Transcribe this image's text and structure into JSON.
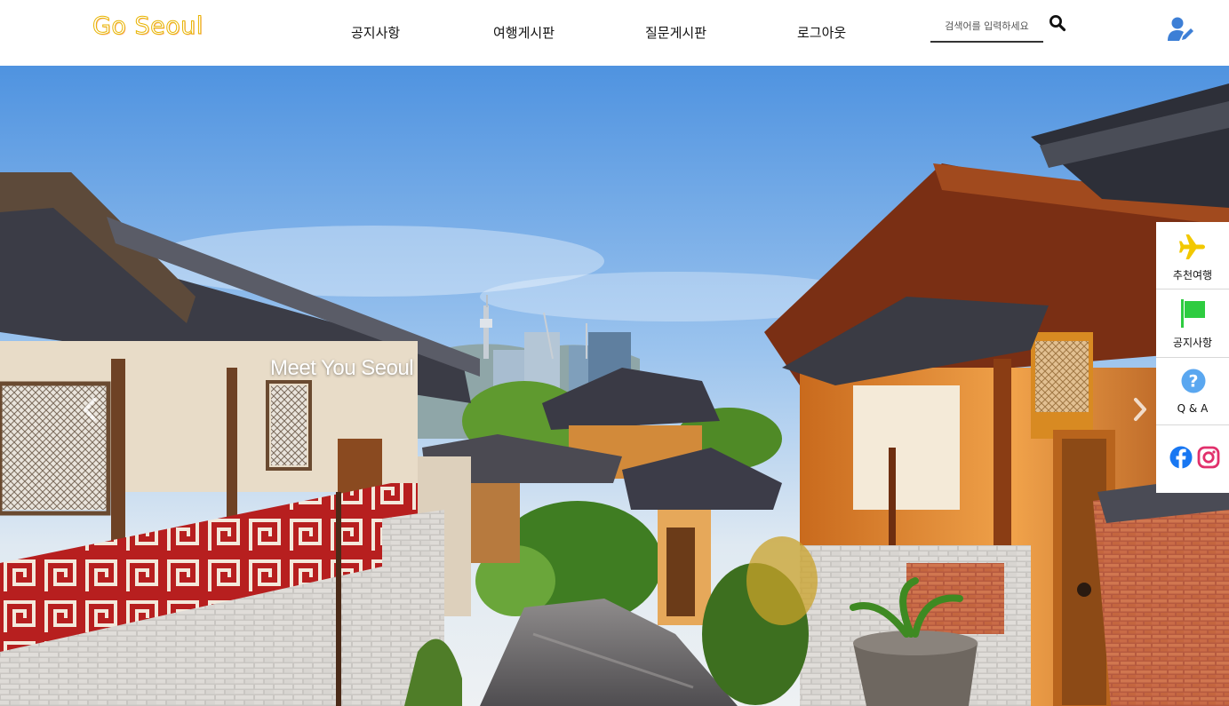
{
  "header": {
    "logo": "Go Seoul",
    "nav": [
      {
        "label": "공지사항"
      },
      {
        "label": "여행게시판"
      },
      {
        "label": "질문게시판"
      },
      {
        "label": "로그아웃"
      }
    ],
    "search": {
      "placeholder": "검색어를 입력하세요",
      "value": ""
    },
    "icons": {
      "search": "search-icon",
      "user": "user-edit-icon"
    }
  },
  "hero": {
    "caption": "Meet You Seoul",
    "prev_icon": "chevron-left-icon",
    "next_icon": "chevron-right-icon"
  },
  "quick_menu": {
    "items": [
      {
        "label": "추천여행",
        "icon": "airplane-icon"
      },
      {
        "label": "공지사항",
        "icon": "flag-icon"
      },
      {
        "label": "Q & A",
        "icon": "question-icon"
      }
    ],
    "social": [
      {
        "icon": "facebook-icon"
      },
      {
        "icon": "instagram-icon"
      }
    ]
  },
  "colors": {
    "logo_outline": "#e8b400",
    "airplane": "#f2c800",
    "flag": "#2ecc40",
    "question": "#5aa7f0",
    "facebook": "#1877f2",
    "instagram": "#e1306c",
    "user_icon": "#3d7fd6"
  }
}
